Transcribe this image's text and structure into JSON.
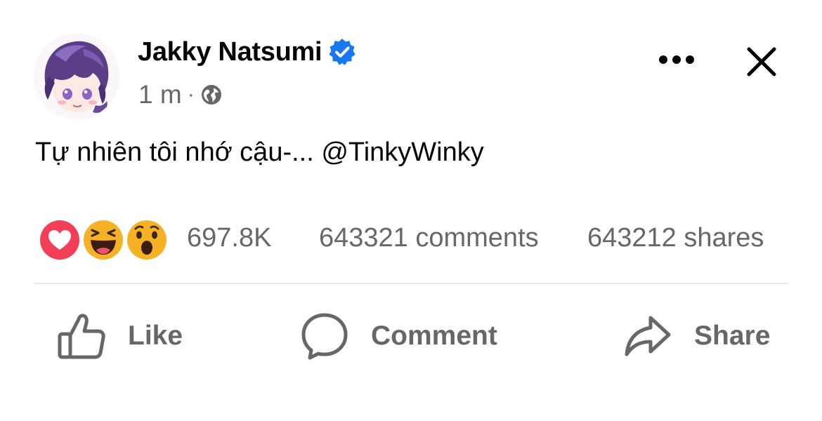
{
  "post": {
    "author": "Jakky Natsumi",
    "time": "1 m",
    "separator": "·",
    "text": "Tự nhiên tôi nhớ cậu-... @TinkyWinky",
    "verified_color": "#1877f2"
  },
  "icons": {
    "verified": "verified-badge-icon",
    "audience": "globe-icon",
    "more": "more-dots-icon",
    "close": "close-icon",
    "like": "thumbs-up-icon",
    "comment": "comment-bubble-icon",
    "share": "share-arrow-icon",
    "reactions": [
      "love-reaction-icon",
      "haha-reaction-icon",
      "wow-reaction-icon"
    ]
  },
  "stats": {
    "reactions": "697.8K",
    "comments": "643321 comments",
    "shares": "643212 shares"
  },
  "actions": {
    "like": "Like",
    "comment": "Comment",
    "share": "Share"
  },
  "colors": {
    "secondary_text": "#65676b",
    "love": "#f33e58",
    "haha": "#f7b125"
  }
}
